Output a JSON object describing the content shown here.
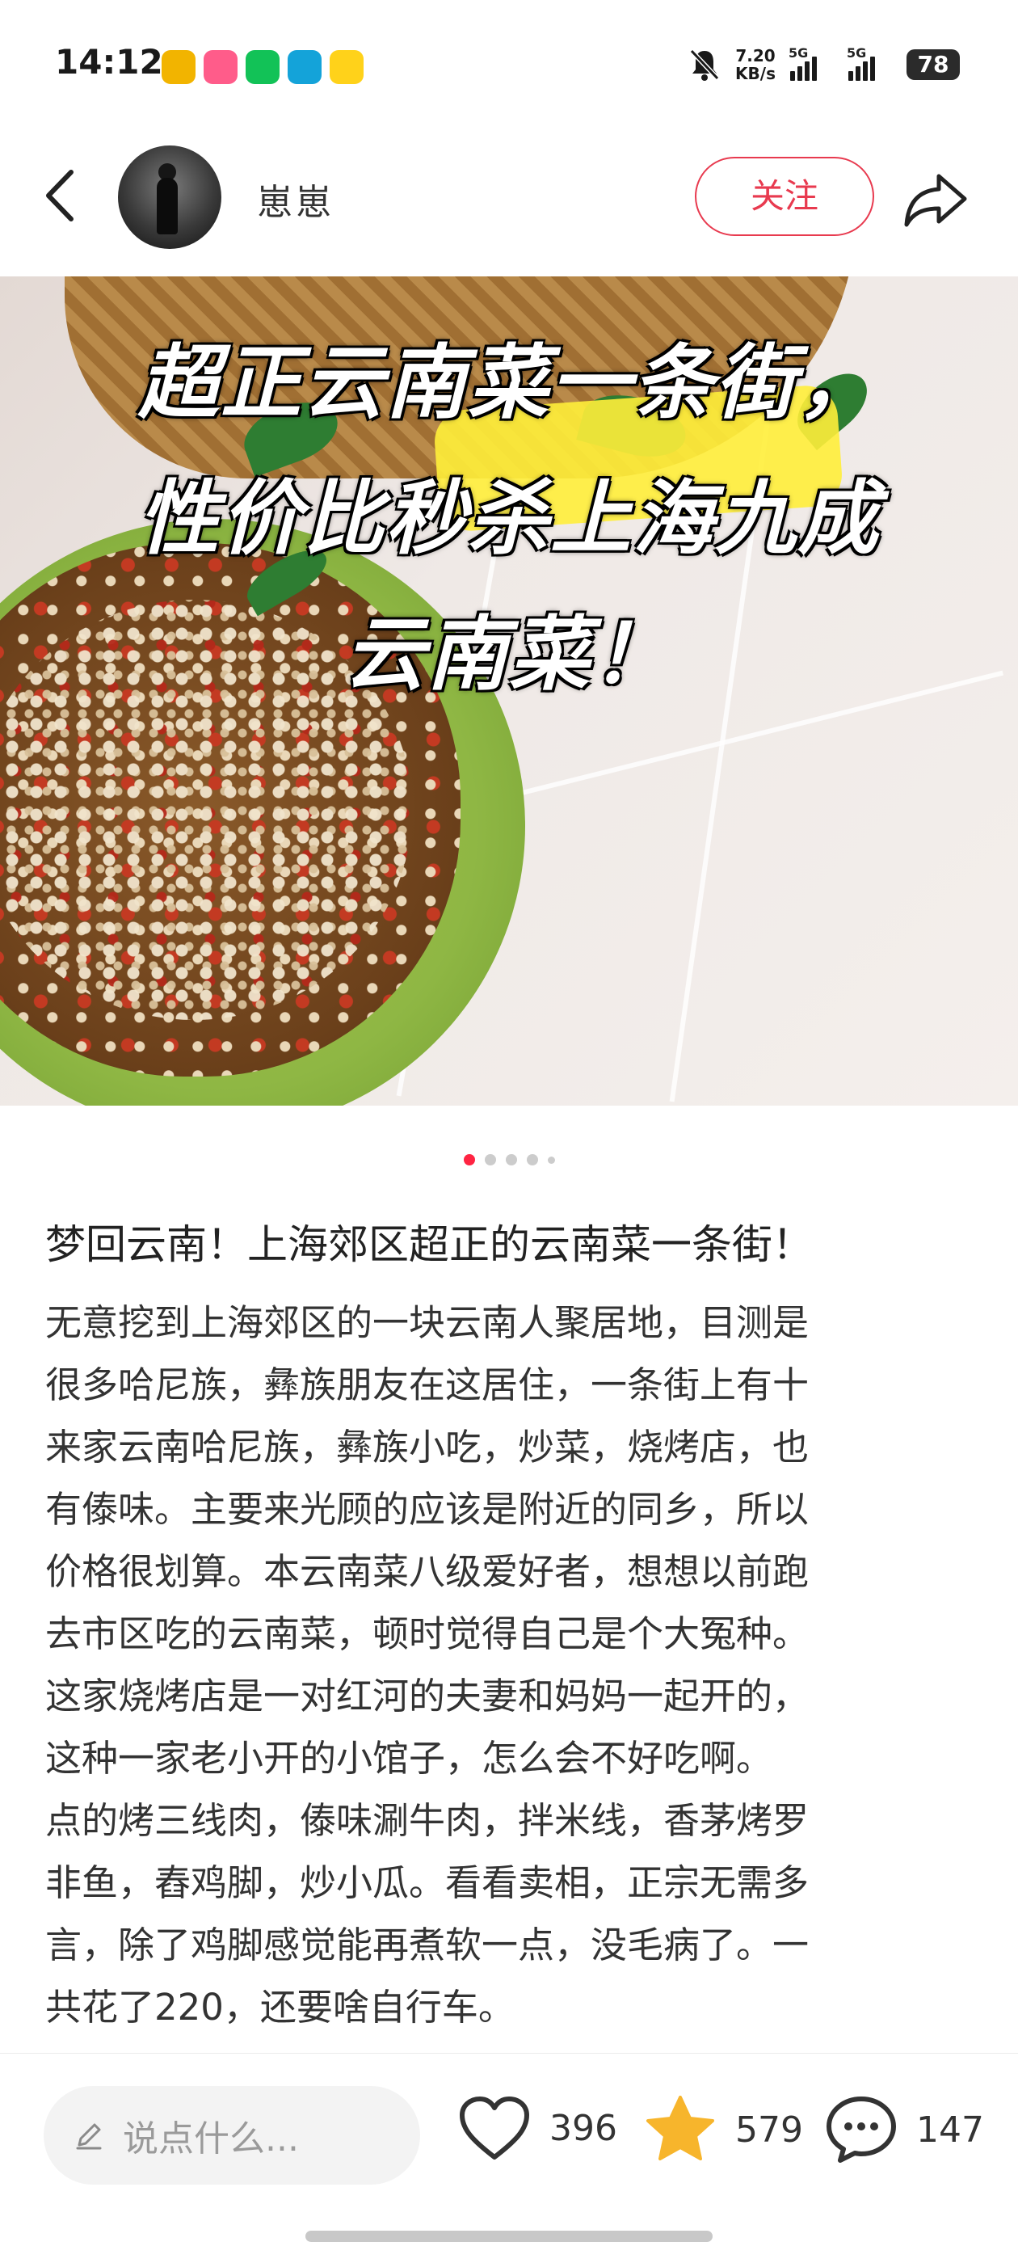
{
  "status_bar": {
    "time": "14:12",
    "net_speed": "7.20",
    "net_speed_unit": "KB/s",
    "signal1": "5G",
    "signal2": "5G",
    "battery": "78",
    "app_icons": [
      "weibo-icon",
      "music-icon",
      "wechat-icon",
      "app-icon",
      "store-icon"
    ],
    "app_icon_colors": [
      "#f2b400",
      "#ff5c8a",
      "#12c257",
      "#14a3d9",
      "#ffd21a"
    ]
  },
  "header": {
    "username": "崽崽",
    "follow_label": "关注"
  },
  "hero": {
    "title_lines": [
      "超正云南菜一条街，",
      "性价比秒杀上海九成",
      "云南菜！"
    ]
  },
  "carousel": {
    "active_index": 0,
    "count": 5
  },
  "post": {
    "title": "梦回云南！上海郊区超正的云南菜一条街！",
    "body_lines": [
      "无意挖到上海郊区的一块云南人聚居地，目测是",
      "很多哈尼族，彝族朋友在这居住，一条街上有十",
      "来家云南哈尼族，彝族小吃，炒菜，烧烤店，也",
      "有傣味。主要来光顾的应该是附近的同乡，所以",
      "价格很划算。本云南菜八级爱好者，想想以前跑",
      "去市区吃的云南菜，顿时觉得自己是个大冤种。",
      "这家烧烤店是一对红河的夫妻和妈妈一起开的，",
      "这种一家老小开的小馆子，怎么会不好吃啊。",
      "点的烤三线肉，傣味涮牛肉，拌米线，香茅烤罗",
      "非鱼，舂鸡脚，炒小瓜。看看卖相，正宗无需多",
      "言，除了鸡脚感觉能再煮软一点，没毛病了。一",
      "共花了220，还要啥自行车。"
    ]
  },
  "bottom_bar": {
    "comment_placeholder": "说点什么...",
    "likes": "396",
    "collects": "579",
    "comments": "147"
  },
  "colors": {
    "accent": "#ff2442",
    "follow": "#e83a4f",
    "star": "#f7b52c"
  }
}
